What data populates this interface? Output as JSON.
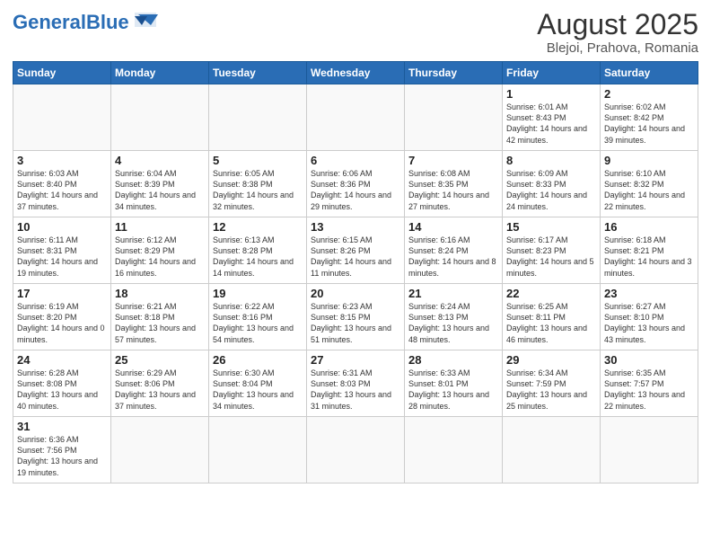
{
  "header": {
    "logo_general": "General",
    "logo_blue": "Blue",
    "month_title": "August 2025",
    "location": "Blejoi, Prahova, Romania"
  },
  "weekdays": [
    "Sunday",
    "Monday",
    "Tuesday",
    "Wednesday",
    "Thursday",
    "Friday",
    "Saturday"
  ],
  "weeks": [
    [
      {
        "day": "",
        "info": ""
      },
      {
        "day": "",
        "info": ""
      },
      {
        "day": "",
        "info": ""
      },
      {
        "day": "",
        "info": ""
      },
      {
        "day": "",
        "info": ""
      },
      {
        "day": "1",
        "info": "Sunrise: 6:01 AM\nSunset: 8:43 PM\nDaylight: 14 hours\nand 42 minutes."
      },
      {
        "day": "2",
        "info": "Sunrise: 6:02 AM\nSunset: 8:42 PM\nDaylight: 14 hours\nand 39 minutes."
      }
    ],
    [
      {
        "day": "3",
        "info": "Sunrise: 6:03 AM\nSunset: 8:40 PM\nDaylight: 14 hours\nand 37 minutes."
      },
      {
        "day": "4",
        "info": "Sunrise: 6:04 AM\nSunset: 8:39 PM\nDaylight: 14 hours\nand 34 minutes."
      },
      {
        "day": "5",
        "info": "Sunrise: 6:05 AM\nSunset: 8:38 PM\nDaylight: 14 hours\nand 32 minutes."
      },
      {
        "day": "6",
        "info": "Sunrise: 6:06 AM\nSunset: 8:36 PM\nDaylight: 14 hours\nand 29 minutes."
      },
      {
        "day": "7",
        "info": "Sunrise: 6:08 AM\nSunset: 8:35 PM\nDaylight: 14 hours\nand 27 minutes."
      },
      {
        "day": "8",
        "info": "Sunrise: 6:09 AM\nSunset: 8:33 PM\nDaylight: 14 hours\nand 24 minutes."
      },
      {
        "day": "9",
        "info": "Sunrise: 6:10 AM\nSunset: 8:32 PM\nDaylight: 14 hours\nand 22 minutes."
      }
    ],
    [
      {
        "day": "10",
        "info": "Sunrise: 6:11 AM\nSunset: 8:31 PM\nDaylight: 14 hours\nand 19 minutes."
      },
      {
        "day": "11",
        "info": "Sunrise: 6:12 AM\nSunset: 8:29 PM\nDaylight: 14 hours\nand 16 minutes."
      },
      {
        "day": "12",
        "info": "Sunrise: 6:13 AM\nSunset: 8:28 PM\nDaylight: 14 hours\nand 14 minutes."
      },
      {
        "day": "13",
        "info": "Sunrise: 6:15 AM\nSunset: 8:26 PM\nDaylight: 14 hours\nand 11 minutes."
      },
      {
        "day": "14",
        "info": "Sunrise: 6:16 AM\nSunset: 8:24 PM\nDaylight: 14 hours\nand 8 minutes."
      },
      {
        "day": "15",
        "info": "Sunrise: 6:17 AM\nSunset: 8:23 PM\nDaylight: 14 hours\nand 5 minutes."
      },
      {
        "day": "16",
        "info": "Sunrise: 6:18 AM\nSunset: 8:21 PM\nDaylight: 14 hours\nand 3 minutes."
      }
    ],
    [
      {
        "day": "17",
        "info": "Sunrise: 6:19 AM\nSunset: 8:20 PM\nDaylight: 14 hours\nand 0 minutes."
      },
      {
        "day": "18",
        "info": "Sunrise: 6:21 AM\nSunset: 8:18 PM\nDaylight: 13 hours\nand 57 minutes."
      },
      {
        "day": "19",
        "info": "Sunrise: 6:22 AM\nSunset: 8:16 PM\nDaylight: 13 hours\nand 54 minutes."
      },
      {
        "day": "20",
        "info": "Sunrise: 6:23 AM\nSunset: 8:15 PM\nDaylight: 13 hours\nand 51 minutes."
      },
      {
        "day": "21",
        "info": "Sunrise: 6:24 AM\nSunset: 8:13 PM\nDaylight: 13 hours\nand 48 minutes."
      },
      {
        "day": "22",
        "info": "Sunrise: 6:25 AM\nSunset: 8:11 PM\nDaylight: 13 hours\nand 46 minutes."
      },
      {
        "day": "23",
        "info": "Sunrise: 6:27 AM\nSunset: 8:10 PM\nDaylight: 13 hours\nand 43 minutes."
      }
    ],
    [
      {
        "day": "24",
        "info": "Sunrise: 6:28 AM\nSunset: 8:08 PM\nDaylight: 13 hours\nand 40 minutes."
      },
      {
        "day": "25",
        "info": "Sunrise: 6:29 AM\nSunset: 8:06 PM\nDaylight: 13 hours\nand 37 minutes."
      },
      {
        "day": "26",
        "info": "Sunrise: 6:30 AM\nSunset: 8:04 PM\nDaylight: 13 hours\nand 34 minutes."
      },
      {
        "day": "27",
        "info": "Sunrise: 6:31 AM\nSunset: 8:03 PM\nDaylight: 13 hours\nand 31 minutes."
      },
      {
        "day": "28",
        "info": "Sunrise: 6:33 AM\nSunset: 8:01 PM\nDaylight: 13 hours\nand 28 minutes."
      },
      {
        "day": "29",
        "info": "Sunrise: 6:34 AM\nSunset: 7:59 PM\nDaylight: 13 hours\nand 25 minutes."
      },
      {
        "day": "30",
        "info": "Sunrise: 6:35 AM\nSunset: 7:57 PM\nDaylight: 13 hours\nand 22 minutes."
      }
    ],
    [
      {
        "day": "31",
        "info": "Sunrise: 6:36 AM\nSunset: 7:56 PM\nDaylight: 13 hours\nand 19 minutes."
      },
      {
        "day": "",
        "info": ""
      },
      {
        "day": "",
        "info": ""
      },
      {
        "day": "",
        "info": ""
      },
      {
        "day": "",
        "info": ""
      },
      {
        "day": "",
        "info": ""
      },
      {
        "day": "",
        "info": ""
      }
    ]
  ]
}
